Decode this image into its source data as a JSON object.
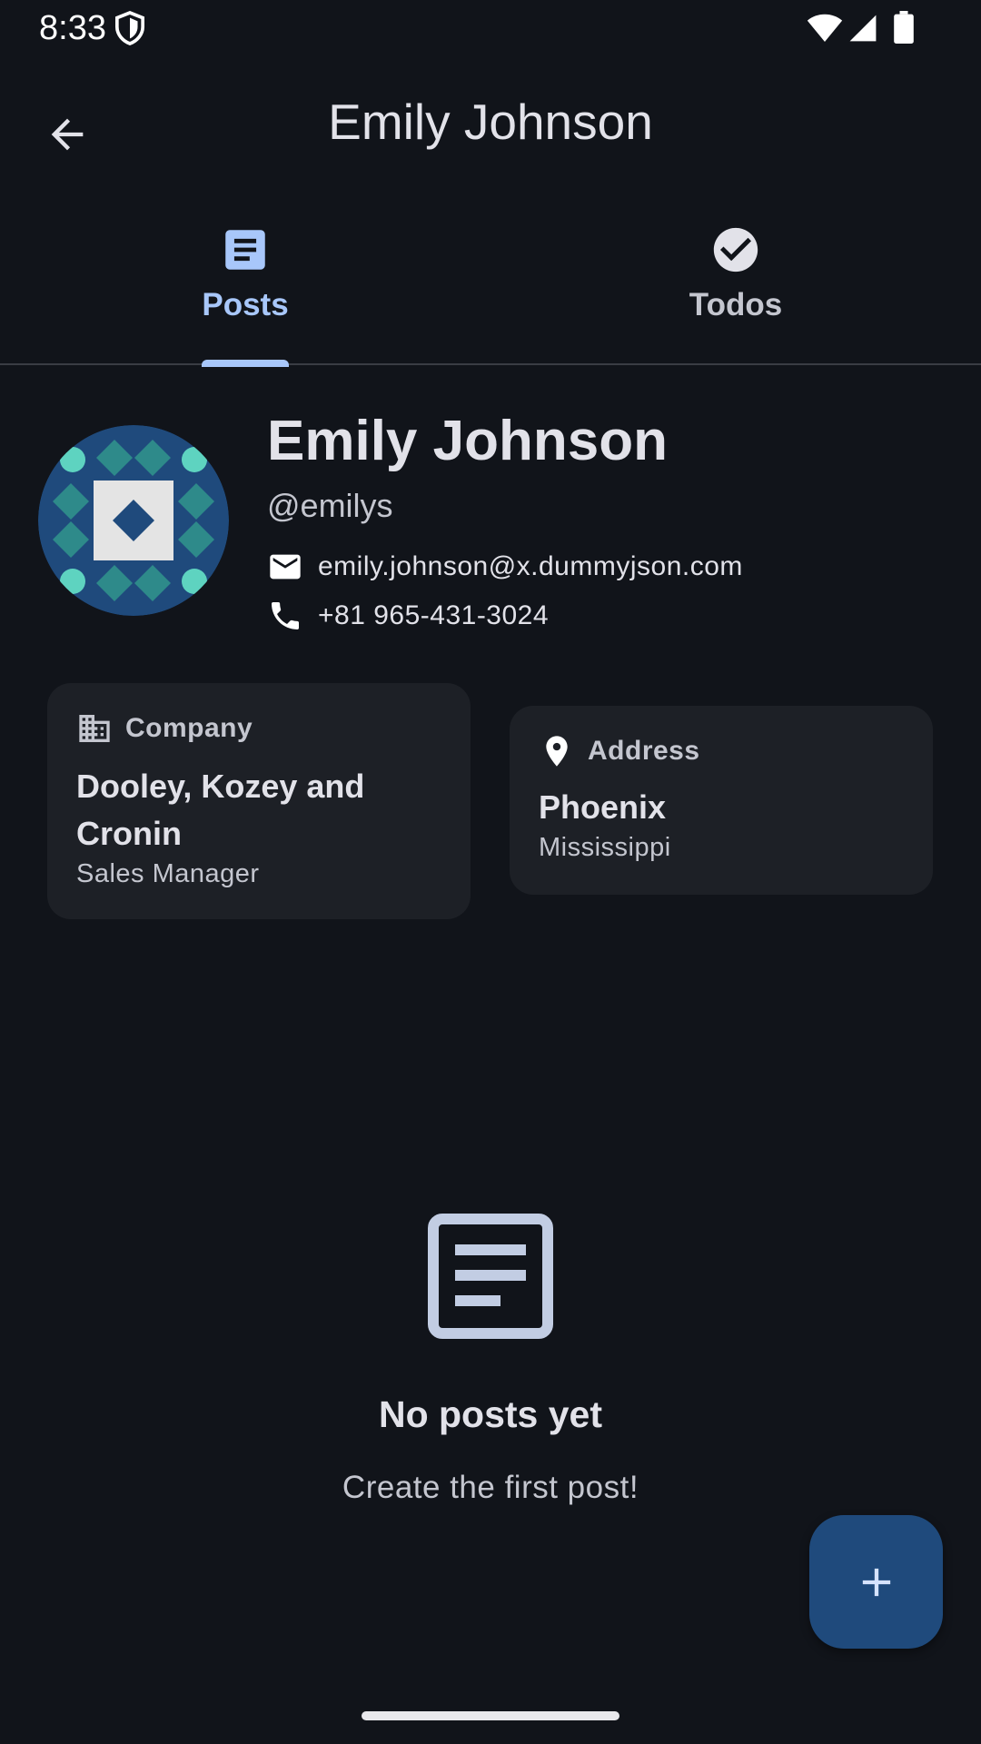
{
  "status_bar": {
    "time": "8:33",
    "icons": [
      "shield-icon",
      "wifi-icon",
      "signal-icon",
      "battery-icon"
    ]
  },
  "app_bar": {
    "title": "Emily Johnson",
    "back_icon": "arrow-back-icon"
  },
  "tabs": [
    {
      "label": "Posts",
      "icon": "article-icon",
      "selected": true
    },
    {
      "label": "Todos",
      "icon": "check-circle-icon",
      "selected": false
    }
  ],
  "profile": {
    "name": "Emily Johnson",
    "username": "@emilys",
    "email": "emily.johnson@x.dummyjson.com",
    "phone": "+81 965-431-3024"
  },
  "company_card": {
    "heading": "Company",
    "name_line1": "Dooley, Kozey and",
    "name_line2": "Cronin",
    "title": "Sales Manager"
  },
  "address_card": {
    "heading": "Address",
    "city": "Phoenix",
    "state": "Mississippi"
  },
  "empty_state": {
    "title": "No posts yet",
    "subtitle": "Create the first post!"
  },
  "fab": {
    "icon": "add-icon"
  },
  "colors": {
    "background": "#11141a",
    "accent": "#a8c7fa",
    "card": "#1d2026",
    "fab": "#1f4a7c"
  }
}
